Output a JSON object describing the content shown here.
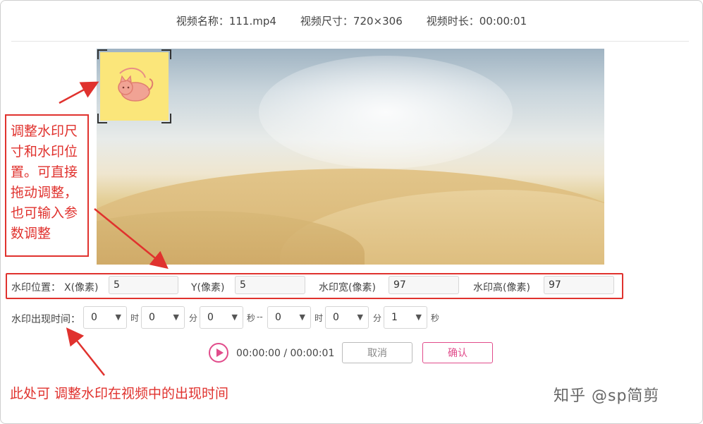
{
  "header": {
    "file_name_label": "视频名称：111.mp4",
    "size_label": "视频尺寸：720×306",
    "duration_label": "视频时长：00:00:01"
  },
  "annotations": {
    "position_note": [
      "调整水印尺",
      "寸和水印位",
      "置。可直接",
      "拖动调整，",
      "也可输入参",
      "数调整"
    ],
    "time_note": "此处可 调整水印在视频中的出现时间"
  },
  "position": {
    "section_label": "水印位置：",
    "x_label": "X(像素)",
    "x_value": "5",
    "y_label": "Y(像素)",
    "y_value": "5",
    "width_label": "水印宽(像素)",
    "width_value": "97",
    "height_label": "水印高(像素)",
    "height_value": "97"
  },
  "timing": {
    "section_label": "水印出现时间：",
    "start_hour": "0",
    "start_minute": "0",
    "start_second": "0",
    "end_hour": "0",
    "end_minute": "0",
    "end_second": "1",
    "unit_hour": "时",
    "unit_minute": "分",
    "unit_second": "秒",
    "separator": "--"
  },
  "player": {
    "timecode": "00:00:00 / 00:00:01",
    "cancel_label": "取消",
    "confirm_label": "确认"
  },
  "brand": "知乎 @sp简剪",
  "colors": {
    "annotation_red": "#e0322e",
    "accent_pink": "#e14c8b",
    "watermark_bg": "#fbe67a"
  }
}
